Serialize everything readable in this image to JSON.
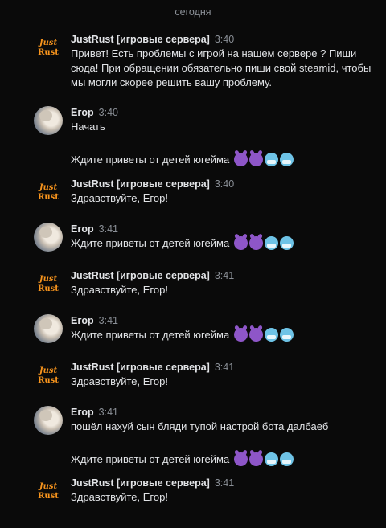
{
  "date_separator": "сегодня",
  "messages": [
    {
      "author": "JustRust [игровые сервера]",
      "time": "3:40",
      "lines": [
        "Привет! Есть проблемы с игрой на нашем сервере ? Пиши сюда! При обращении обязательно пиши свой steamid, чтобы мы могли скорее решить вашу проблему."
      ],
      "avatar": "logo"
    },
    {
      "author": "Егор",
      "time": "3:40",
      "lines": [
        "Начать",
        "Ждите приветы от детей югейма"
      ],
      "avatar": "photo"
    },
    {
      "author": "JustRust [игровые сервера]",
      "time": "3:40",
      "lines": [
        "Здравствуйте, Егор!"
      ],
      "avatar": "logo"
    },
    {
      "author": "Егор",
      "time": "3:41",
      "lines": [
        "Ждите приветы от детей югейма"
      ],
      "avatar": "photo"
    },
    {
      "author": "JustRust [игровые сервера]",
      "time": "3:41",
      "lines": [
        "Здравствуйте, Егор!"
      ],
      "avatar": "logo"
    },
    {
      "author": "Егор",
      "time": "3:41",
      "lines": [
        "Ждите приветы от детей югейма"
      ],
      "avatar": "photo"
    },
    {
      "author": "JustRust [игровые сервера]",
      "time": "3:41",
      "lines": [
        "Здравствуйте, Егор!"
      ],
      "avatar": "logo"
    },
    {
      "author": "Егор",
      "time": "3:41",
      "lines": [
        "пошёл нахуй сын бляди тупой настрой бота далбаеб",
        "Ждите приветы от детей югейма"
      ],
      "avatar": "photo"
    },
    {
      "author": "JustRust [игровые сервера]",
      "time": "3:41",
      "lines": [
        "Здравствуйте, Егор!"
      ],
      "avatar": "logo"
    }
  ],
  "emoji_sequence": [
    "smiling-imp",
    "smiling-imp",
    "cold-face",
    "cold-face"
  ],
  "colors": {
    "background": "#0a0a0a",
    "text": "#e1e3e6",
    "muted": "#8a8f96",
    "logo_orange": "#f7941d"
  }
}
